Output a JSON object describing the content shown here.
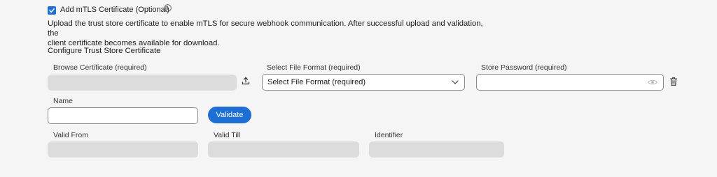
{
  "mtls": {
    "checkbox_checked": true,
    "checkbox_label": "Add mTLS Certificate (Optional)",
    "info_icon": "info-circle-icon",
    "description_line1": "Upload the trust store certificate to enable mTLS for secure webhook communication. After successful upload and validation, the",
    "description_line2": "client certificate becomes available for download."
  },
  "trust_store": {
    "section_title": "Configure Trust Store Certificate",
    "browse_label": "Browse Certificate (required)",
    "browse_value": "",
    "upload_icon": "upload-icon",
    "format_label": "Select File Format (required)",
    "format_selected": "Select File Format (required)",
    "password_label": "Store Password (required)",
    "password_value": "",
    "eye_icon": "eye-icon",
    "delete_icon": "trash-icon",
    "name_label": "Name",
    "name_value": "",
    "validate_label": "Validate",
    "valid_from_label": "Valid From",
    "valid_from_value": "",
    "valid_till_label": "Valid Till",
    "valid_till_value": "",
    "identifier_label": "Identifier",
    "identifier_value": ""
  },
  "colors": {
    "accent": "#1d6fd3",
    "background": "#f5f5f5",
    "disabled_field": "#dcdcdc"
  }
}
